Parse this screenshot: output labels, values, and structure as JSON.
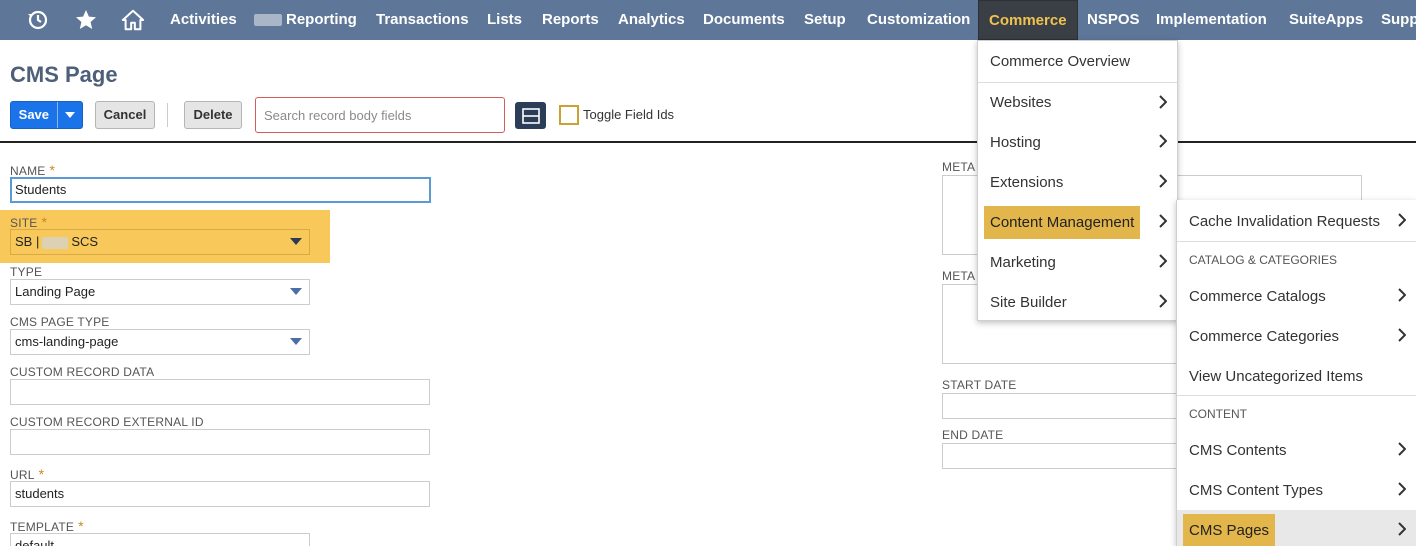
{
  "nav": {
    "items": [
      "Activities",
      "Reporting",
      "Transactions",
      "Lists",
      "Reports",
      "Analytics",
      "Documents",
      "Setup",
      "Customization",
      "Commerce",
      "NSPOS",
      "Implementation",
      "SuiteApps",
      "Supp"
    ],
    "active": "Commerce",
    "icons": [
      "history-icon",
      "star-icon",
      "home-icon"
    ]
  },
  "page": {
    "title": "CMS Page"
  },
  "toolbar": {
    "save": "Save",
    "cancel": "Cancel",
    "delete": "Delete",
    "search_placeholder": "Search record body fields",
    "toggle_field_ids": "Toggle Field Ids"
  },
  "form": {
    "name": {
      "label": "NAME",
      "value": "Students"
    },
    "site": {
      "label": "SITE",
      "value_prefix": "SB |",
      "value_suffix": "SCS"
    },
    "type": {
      "label": "TYPE",
      "value": "Landing Page"
    },
    "cms_page_type": {
      "label": "CMS PAGE TYPE",
      "value": "cms-landing-page"
    },
    "custom_record_data": {
      "label": "CUSTOM RECORD DATA",
      "value": ""
    },
    "custom_record_external_id": {
      "label": "CUSTOM RECORD EXTERNAL ID",
      "value": ""
    },
    "url": {
      "label": "URL",
      "value": "students"
    },
    "template": {
      "label": "TEMPLATE",
      "value": "default"
    },
    "meta1": {
      "label": "META"
    },
    "meta2": {
      "label": "META"
    },
    "start_date": {
      "label": "START DATE"
    },
    "end_date": {
      "label": "END DATE"
    }
  },
  "commerce_menu": [
    "Commerce Overview",
    "Websites",
    "Hosting",
    "Extensions",
    "Content Management",
    "Marketing",
    "Site Builder"
  ],
  "content_management_menu": {
    "cache_invalidation": "Cache Invalidation Requests",
    "section_catalog": "CATALOG & CATEGORIES",
    "commerce_catalogs": "Commerce Catalogs",
    "commerce_categories": "Commerce Categories",
    "view_uncategorized": "View Uncategorized Items",
    "section_content": "CONTENT",
    "cms_contents": "CMS Contents",
    "cms_content_types": "CMS Content Types",
    "cms_pages": "CMS Pages"
  },
  "colors": {
    "nav_bg": "#5e7698",
    "active_text": "#f0c24e",
    "highlight": "#e2b64a",
    "save_blue": "#1a73e8"
  }
}
